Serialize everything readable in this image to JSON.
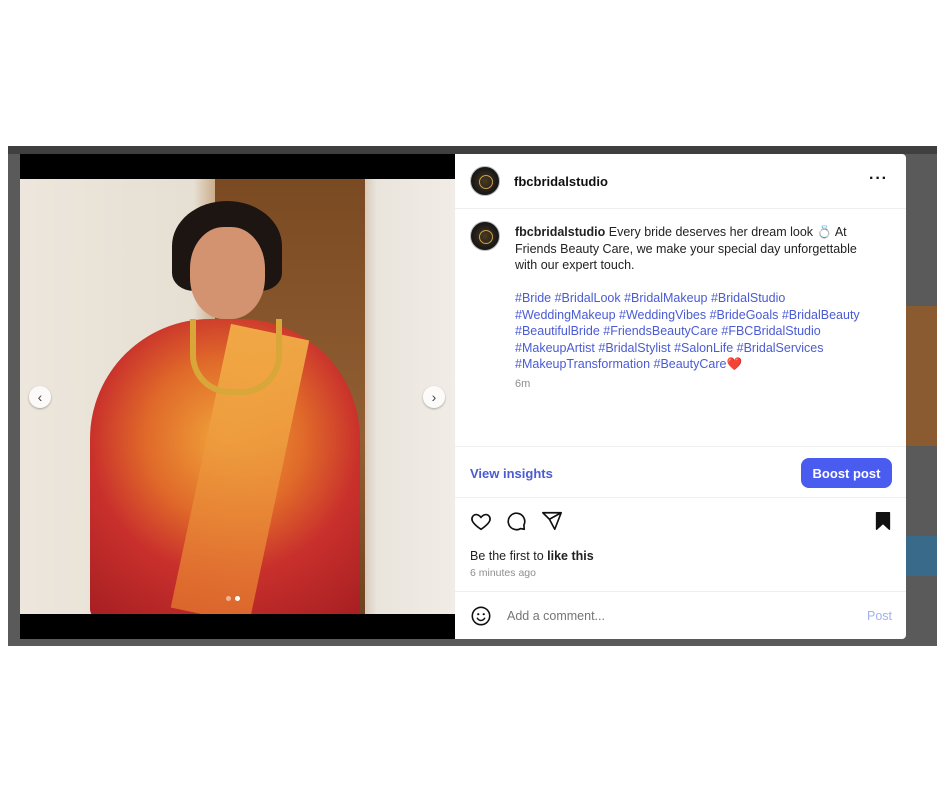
{
  "post": {
    "username": "fbcbridalstudio",
    "caption_user": "fbcbridalstudio",
    "caption_text": "Every bride deserves her dream look 💍 At Friends Beauty Care, we make your special day unforgettable with our expert touch.",
    "hashtags": "#Bride #BridalLook #BridalMakeup #BridalStudio #WeddingMakeup #WeddingVibes #BrideGoals #BridalBeauty #BeautifulBride #FriendsBeautyCare #FBCBridalStudio #MakeupArtist #BridalStylist #SalonLife #BridalServices #MakeupTransformation #BeautyCare❤️",
    "time": "6m",
    "more_label": "···"
  },
  "actions": {
    "view_insights": "View insights",
    "boost_post": "Boost post",
    "likes_prefix": "Be the first to ",
    "likes_bold": "like this",
    "posted_ago": "6 minutes ago"
  },
  "comment": {
    "placeholder": "Add a comment...",
    "post_label": "Post"
  },
  "carousel": {
    "prev": "‹",
    "next": "›",
    "slide_count": 2,
    "active_index": 1
  },
  "colors": {
    "link": "#4a5bd4",
    "boost_bg": "#4a5bf0",
    "post_disabled": "#9fb0f0"
  }
}
